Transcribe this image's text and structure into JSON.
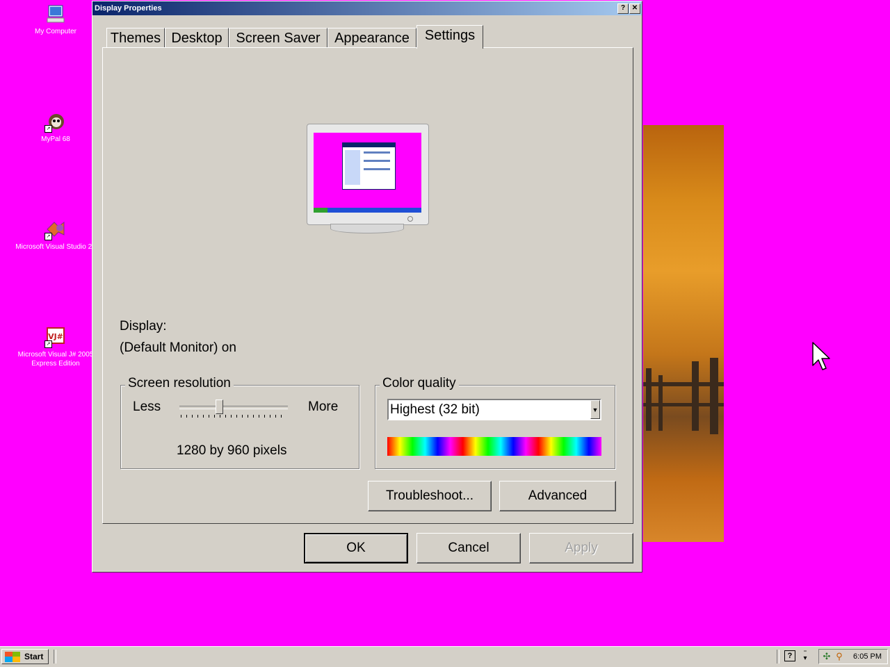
{
  "desktop": {
    "icons": [
      {
        "label": "My Computer"
      },
      {
        "label": "MyPal 68"
      },
      {
        "label": "Microsoft Visual Studio 20"
      },
      {
        "label": "Microsoft Visual J# 2005 Express Edition"
      }
    ]
  },
  "dialog": {
    "title": "Display Properties",
    "help_btn": "?",
    "close_btn": "✕",
    "tabs": [
      {
        "label": "Themes"
      },
      {
        "label": "Desktop"
      },
      {
        "label": "Screen Saver"
      },
      {
        "label": "Appearance"
      },
      {
        "label": "Settings"
      }
    ],
    "active_tab": "Settings",
    "display_label": "Display:",
    "display_value": "(Default Monitor) on",
    "resolution": {
      "title": "Screen resolution",
      "less": "Less",
      "more": "More",
      "value": "1280 by 960 pixels"
    },
    "color_quality": {
      "title": "Color quality",
      "selected": "Highest (32 bit)"
    },
    "buttons": {
      "troubleshoot": "Troubleshoot...",
      "advanced": "Advanced",
      "ok": "OK",
      "cancel": "Cancel",
      "apply": "Apply"
    }
  },
  "taskbar": {
    "start": "Start",
    "clock": "6:05 PM",
    "help_icon": "?"
  }
}
